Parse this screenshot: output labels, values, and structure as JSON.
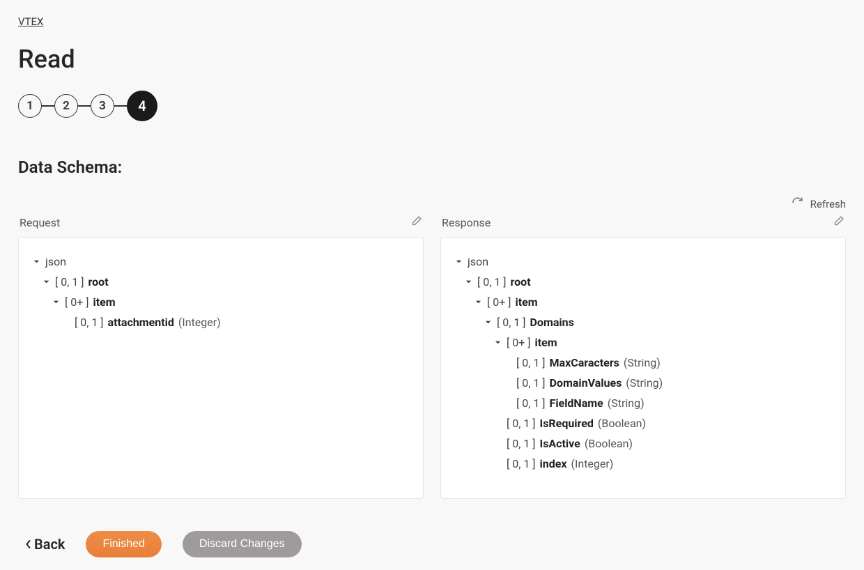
{
  "breadcrumb": {
    "label": "VTEX"
  },
  "page": {
    "title": "Read"
  },
  "stepper": {
    "steps": [
      {
        "label": "1",
        "active": false
      },
      {
        "label": "2",
        "active": false
      },
      {
        "label": "3",
        "active": false
      },
      {
        "label": "4",
        "active": true
      }
    ]
  },
  "section": {
    "heading": "Data Schema:"
  },
  "refresh": {
    "label": "Refresh"
  },
  "panels": {
    "request": {
      "title": "Request",
      "tree": [
        {
          "indent": 0,
          "expandable": true,
          "card": "",
          "name": "json",
          "name_bold": false,
          "type": ""
        },
        {
          "indent": 1,
          "expandable": true,
          "card": "[ 0, 1 ]",
          "name": "root",
          "name_bold": true,
          "type": ""
        },
        {
          "indent": 2,
          "expandable": true,
          "card": "[ 0+ ]",
          "name": "item",
          "name_bold": true,
          "type": ""
        },
        {
          "indent": 3,
          "expandable": false,
          "card": "[ 0, 1 ]",
          "name": "attachmentid",
          "name_bold": true,
          "type": "(Integer)"
        }
      ]
    },
    "response": {
      "title": "Response",
      "tree": [
        {
          "indent": 0,
          "expandable": true,
          "card": "",
          "name": "json",
          "name_bold": false,
          "type": ""
        },
        {
          "indent": 1,
          "expandable": true,
          "card": "[ 0, 1 ]",
          "name": "root",
          "name_bold": true,
          "type": ""
        },
        {
          "indent": 2,
          "expandable": true,
          "card": "[ 0+ ]",
          "name": "item",
          "name_bold": true,
          "type": ""
        },
        {
          "indent": 3,
          "expandable": true,
          "card": "[ 0, 1 ]",
          "name": "Domains",
          "name_bold": true,
          "type": ""
        },
        {
          "indent": 4,
          "expandable": true,
          "card": "[ 0+ ]",
          "name": "item",
          "name_bold": true,
          "type": ""
        },
        {
          "indent": 5,
          "expandable": false,
          "card": "[ 0, 1 ]",
          "name": "MaxCaracters",
          "name_bold": true,
          "type": "(String)"
        },
        {
          "indent": 5,
          "expandable": false,
          "card": "[ 0, 1 ]",
          "name": "DomainValues",
          "name_bold": true,
          "type": "(String)"
        },
        {
          "indent": 5,
          "expandable": false,
          "card": "[ 0, 1 ]",
          "name": "FieldName",
          "name_bold": true,
          "type": "(String)"
        },
        {
          "indent": 4,
          "expandable": false,
          "card": "[ 0, 1 ]",
          "name": "IsRequired",
          "name_bold": true,
          "type": "(Boolean)"
        },
        {
          "indent": 4,
          "expandable": false,
          "card": "[ 0, 1 ]",
          "name": "IsActive",
          "name_bold": true,
          "type": "(Boolean)"
        },
        {
          "indent": 4,
          "expandable": false,
          "card": "[ 0, 1 ]",
          "name": "index",
          "name_bold": true,
          "type": "(Integer)"
        }
      ]
    }
  },
  "footer": {
    "back": "Back",
    "finished": "Finished",
    "discard": "Discard Changes"
  }
}
